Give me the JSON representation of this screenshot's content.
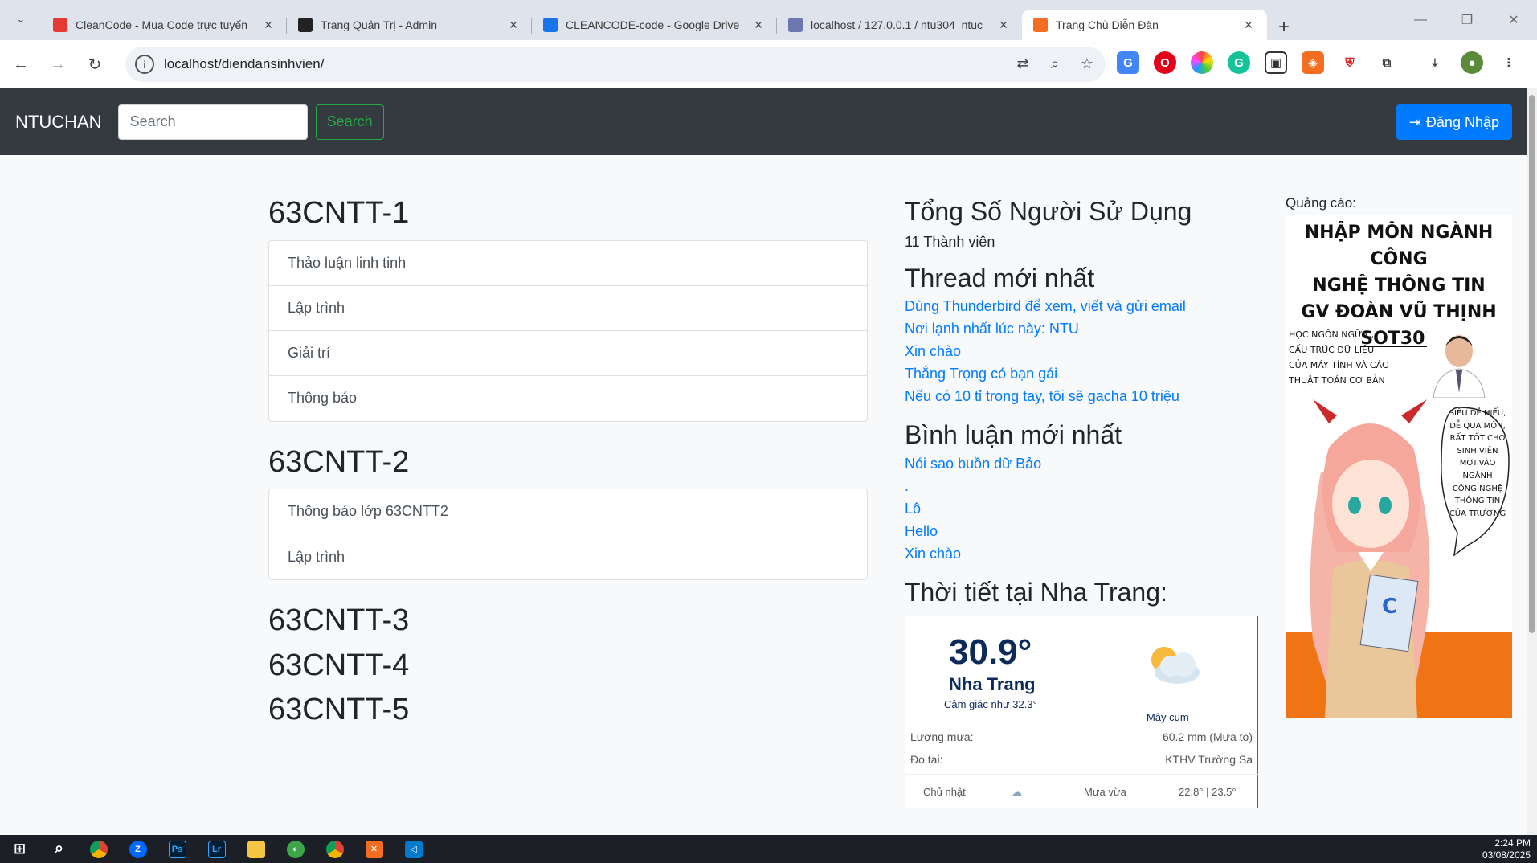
{
  "browser": {
    "tabs": [
      {
        "title": "CleanCode - Mua Code trực tuyến",
        "color": "#e53935"
      },
      {
        "title": "Trang Quản Trị - Admin",
        "color": "#222222"
      },
      {
        "title": "CLEANCODE-code - Google Drive",
        "color": "#1a73e8"
      },
      {
        "title": "localhost / 127.0.0.1 / ntu304_ntuc",
        "color": "#6c78af"
      },
      {
        "title": "Trang Chủ Diễn Đàn",
        "color": "#f36e21"
      }
    ],
    "url": "localhost/diendansinhvien/"
  },
  "navbar": {
    "brand": "NTUCHAN",
    "search_placeholder": "Search",
    "search_button": "Search",
    "login": "Đăng Nhập"
  },
  "classes": [
    {
      "name": "63CNTT-1",
      "topics": [
        "Thảo luận linh tinh",
        "Lập trình",
        "Giải trí",
        "Thông báo"
      ]
    },
    {
      "name": "63CNTT-2",
      "topics": [
        "Thông báo lớp 63CNTT2",
        "Lập trình"
      ]
    },
    {
      "name": "63CNTT-3",
      "topics": []
    },
    {
      "name": "63CNTT-4",
      "topics": []
    },
    {
      "name": "63CNTT-5",
      "topics": []
    }
  ],
  "stats": {
    "users_title": "Tổng Số Người Sử Dụng",
    "users_count": "11 Thành viên",
    "threads_title": "Thread mới nhất",
    "threads": [
      "Dùng Thunderbird để xem, viết và gửi email",
      "Nơi lạnh nhất lúc này: NTU",
      "Xin chào",
      "Thắng Trọng có bạn gái",
      "Nếu có 10 tỉ trong tay, tôi sẽ gacha 10 triệu"
    ],
    "comments_title": "Bình luận mới nhất",
    "comments": [
      "Nói sao buồn dữ Bảo",
      ".",
      "Lô",
      "Hello",
      "Xin chào"
    ],
    "weather_title": "Thời tiết tại Nha Trang:"
  },
  "weather": {
    "temp": "30.9°",
    "city": "Nha Trang",
    "feels": "Cảm giác như 32.3°",
    "desc": "Mây cụm",
    "rain_label": "Lượng mưa:",
    "rain_value": "60.2 mm (Mưa to)",
    "station_label": "Đo tại:",
    "station_value": "KTHV Trường Sa",
    "forecast_day": "Chủ nhật",
    "forecast_desc": "Mưa vừa",
    "forecast_temp": "22.8° | 23.5°"
  },
  "ad": {
    "label": "Quảng cáo:",
    "title_lines": [
      "NHẬP MÔN NGÀNH CÔNG",
      "NGHỆ THÔNG TIN",
      "GV ĐOÀN VŨ THỊNH",
      "SOT301"
    ],
    "left_text": [
      "HỌC NGÔN NGỮ C,",
      "CẤU TRÚC DỮ LIỆU",
      "CỦA MÁY TÍNH VÀ CÁC",
      "THUẬT TOÁN CƠ BẢN"
    ],
    "bubble_text": [
      "SIÊU DỄ HIỂU,",
      "DỄ QUA MÔN,",
      "RẤT TỐT CHO",
      "SINH VIÊN",
      "MỚI VÀO",
      "NGÀNH",
      "CÔNG NGHỆ",
      "THÔNG TIN",
      "CỦA TRƯỜNG"
    ]
  },
  "taskbar": {
    "time": "2:24 PM",
    "date": "03/08/2025"
  }
}
